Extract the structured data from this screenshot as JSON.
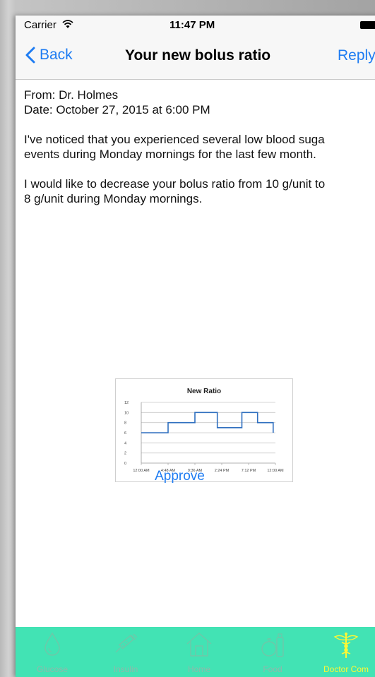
{
  "status_bar": {
    "carrier": "Carrier",
    "time": "11:47 PM"
  },
  "nav": {
    "back_label": "Back",
    "title": "Your new bolus ratio",
    "reply_label": "Reply"
  },
  "message": {
    "from": "From: Dr. Holmes",
    "date": "Date: October 27, 2015 at 6:00 PM",
    "para1_line1": "I've noticed that you experienced several low blood suga",
    "para1_line2": "events during Monday mornings for the last few month.",
    "para2_line1": "I would like to decrease your bolus ratio from 10 g/unit to",
    "para2_line2": "8 g/unit during Monday mornings."
  },
  "chart_data": {
    "type": "line",
    "title": "New Ratio",
    "x": [
      "12:00 AM",
      "4:48 AM",
      "9:36 AM",
      "2:24 PM",
      "7:12 PM",
      "12:00 AM"
    ],
    "series": [
      {
        "x_hours": [
          0,
          4.8,
          4.8,
          9.6,
          9.6,
          13.6,
          13.6,
          18.0,
          18.0,
          20.8,
          20.8,
          23.6,
          23.6
        ],
        "values": [
          6,
          6,
          8,
          8,
          10,
          10,
          7,
          7,
          10,
          10,
          8,
          8,
          6
        ]
      }
    ],
    "ylim": [
      0,
      12
    ],
    "xlim_hours": [
      0,
      24
    ],
    "yticks": [
      0,
      2,
      4,
      6,
      8,
      10,
      12
    ],
    "line_color": "#2f6fbf",
    "grid": true
  },
  "actions": {
    "approve_label": "Approve"
  },
  "tabs": [
    {
      "label": "Glucose",
      "icon": "drop-icon",
      "active": false
    },
    {
      "label": "Insulin",
      "icon": "syringe-icon",
      "active": false
    },
    {
      "label": "Home",
      "icon": "house-icon",
      "active": false
    },
    {
      "label": "Food",
      "icon": "food-icon",
      "active": false
    },
    {
      "label": "Doctor Com",
      "icon": "caduceus-icon",
      "active": true
    }
  ],
  "colors": {
    "accent": "#1e7cf2",
    "tabbar": "#42e3b4",
    "tab_active": "#fff833",
    "tab_inactive": "#8fb9ab"
  }
}
